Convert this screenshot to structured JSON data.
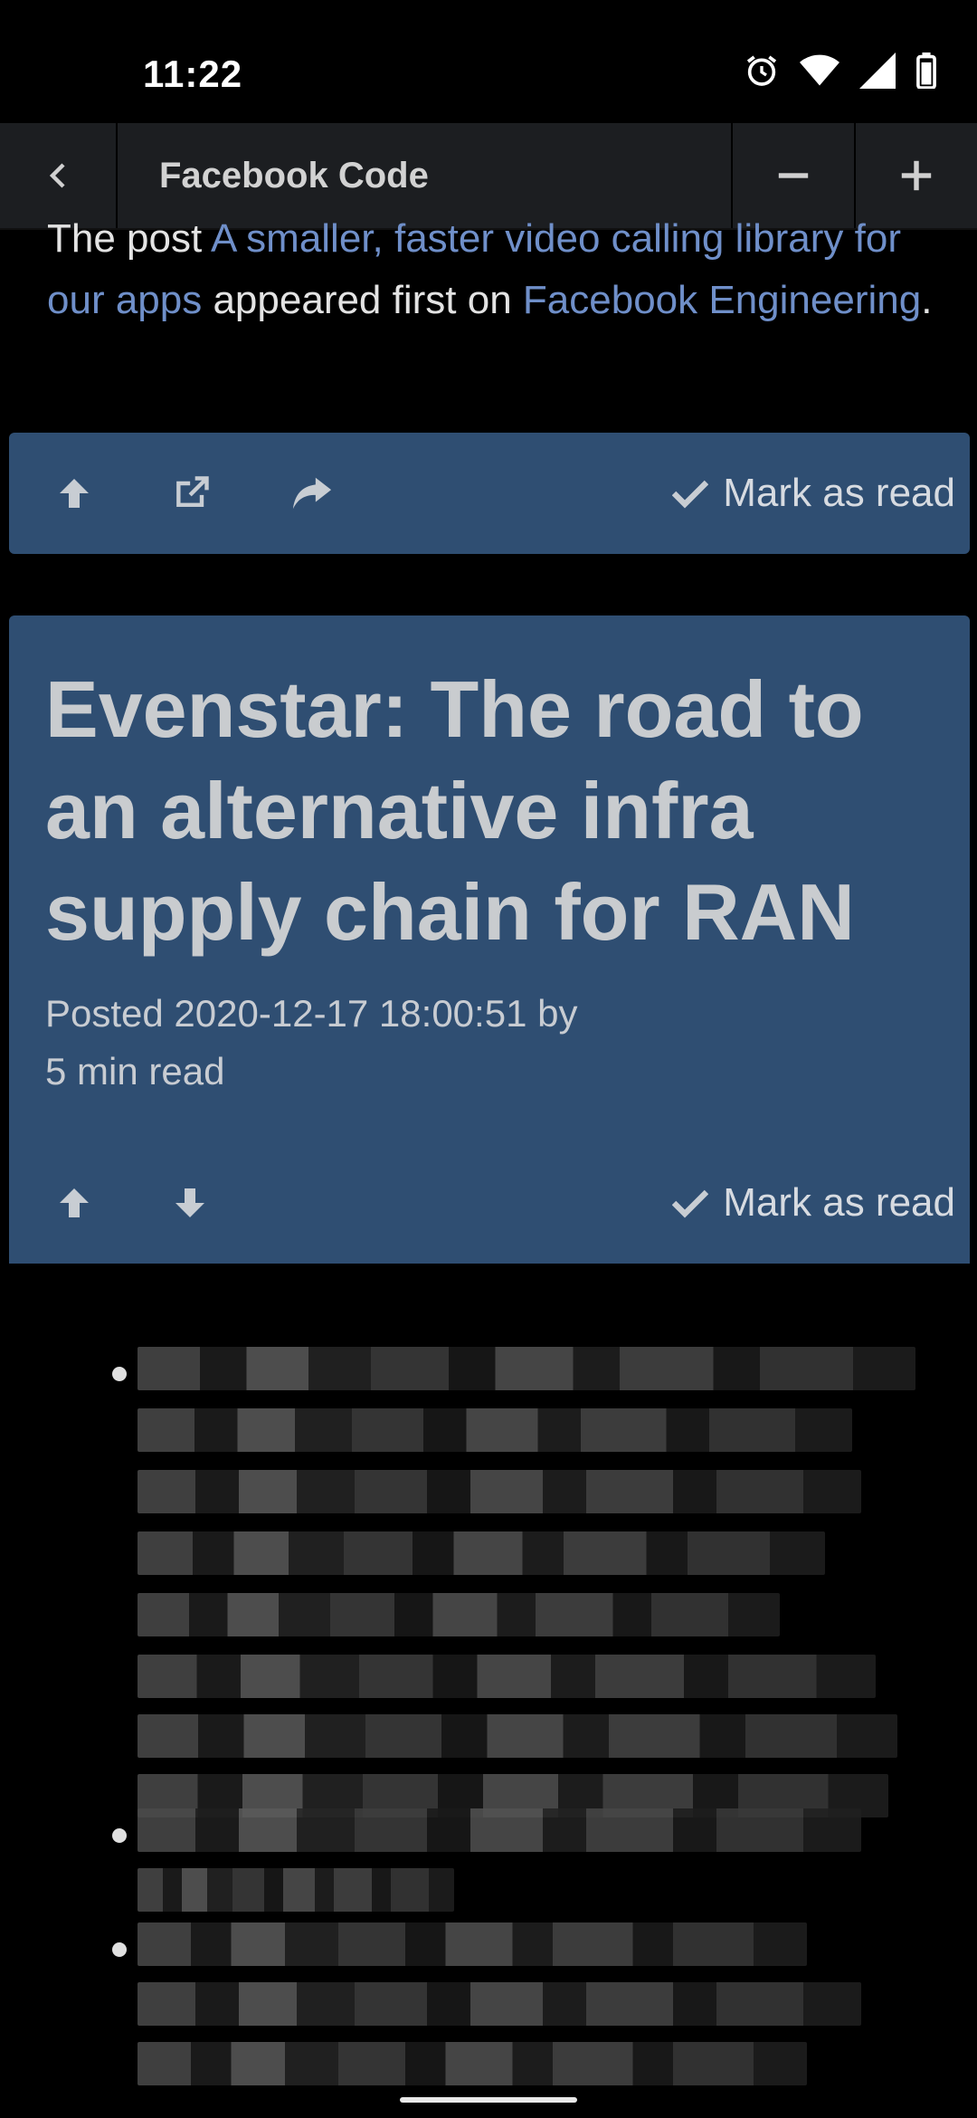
{
  "status_bar": {
    "time": "11:22"
  },
  "toolbar": {
    "title": "Facebook Code",
    "back_icon": "chevron-left-icon",
    "zoom_out_icon": "minus-icon",
    "zoom_in_icon": "plus-icon"
  },
  "previous_post": {
    "prefix": "The post ",
    "link_text": "A smaller, faster video calling library for our apps",
    "middle": " appeared first on ",
    "site_link": "Facebook Engineering",
    "suffix": "."
  },
  "actions_top": {
    "mark_read_label": "Mark as read"
  },
  "article": {
    "title": "Evenstar: The road to an alternative infra supply chain for RAN",
    "posted_line": "Posted 2020-12-17 18:00:51 by",
    "read_time": "5 min read",
    "mark_read_label": "Mark as read"
  },
  "colors": {
    "card_bg": "#2f4e72",
    "link": "#6f8fc9",
    "toolbar_bg": "#1c1e21"
  }
}
